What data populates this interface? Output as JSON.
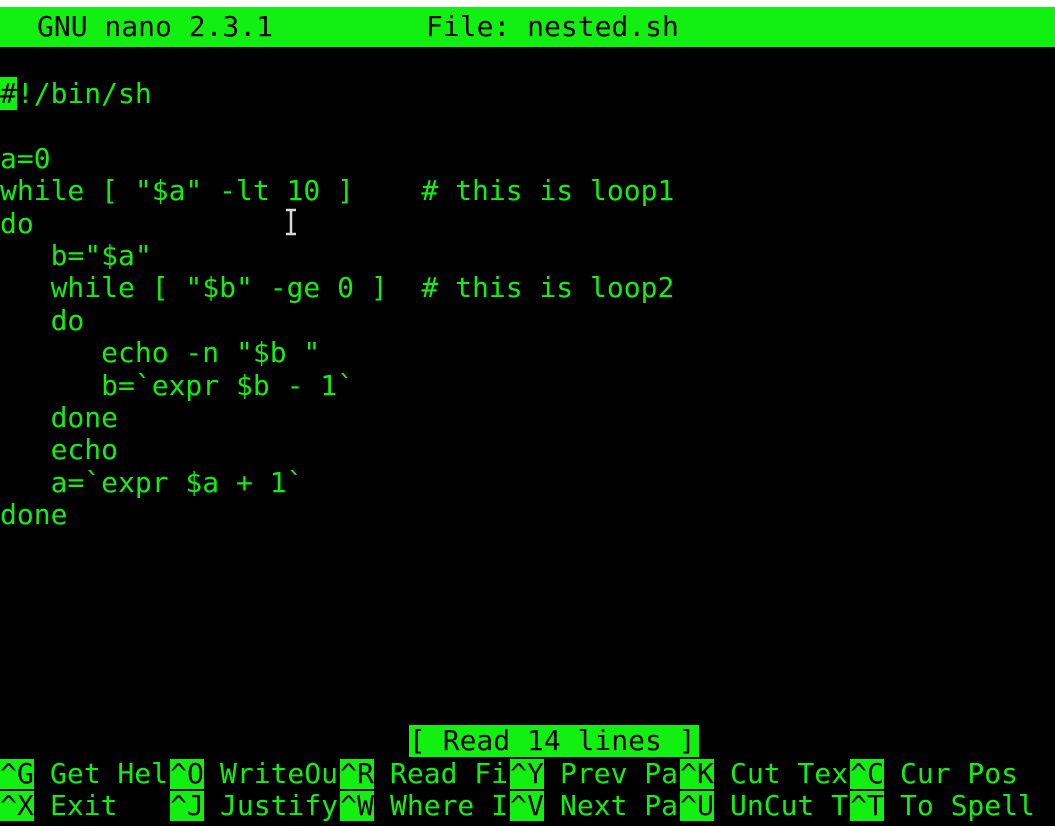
{
  "titlebar": {
    "app": "GNU nano 2.3.1",
    "file": "File: nested.sh"
  },
  "editor": {
    "cursor_char": "#",
    "first_line_rest": "!/bin/sh",
    "lines": [
      "",
      "a=0",
      "while [ \"$a\" -lt 10 ]    # this is loop1",
      "do",
      "   b=\"$a\"",
      "   while [ \"$b\" -ge 0 ]  # this is loop2",
      "   do",
      "      echo -n \"$b \"",
      "      b=`expr $b - 1`",
      "   done",
      "   echo",
      "   a=`expr $a + 1`",
      "done"
    ]
  },
  "status": "[ Read 14 lines ]",
  "shortcuts": {
    "row1": [
      {
        "key": "^G",
        "label": "Get Hel"
      },
      {
        "key": "^O",
        "label": "WriteOu"
      },
      {
        "key": "^R",
        "label": "Read Fi"
      },
      {
        "key": "^Y",
        "label": "Prev Pa"
      },
      {
        "key": "^K",
        "label": "Cut Tex"
      },
      {
        "key": "^C",
        "label": "Cur Pos"
      }
    ],
    "row2": [
      {
        "key": "^X",
        "label": "Exit"
      },
      {
        "key": "^J",
        "label": "Justify"
      },
      {
        "key": "^W",
        "label": "Where I"
      },
      {
        "key": "^V",
        "label": "Next Pa"
      },
      {
        "key": "^U",
        "label": "UnCut T"
      },
      {
        "key": "^T",
        "label": "To Spell"
      }
    ]
  },
  "colors": {
    "foreground": "#11f011",
    "background": "#000000"
  }
}
